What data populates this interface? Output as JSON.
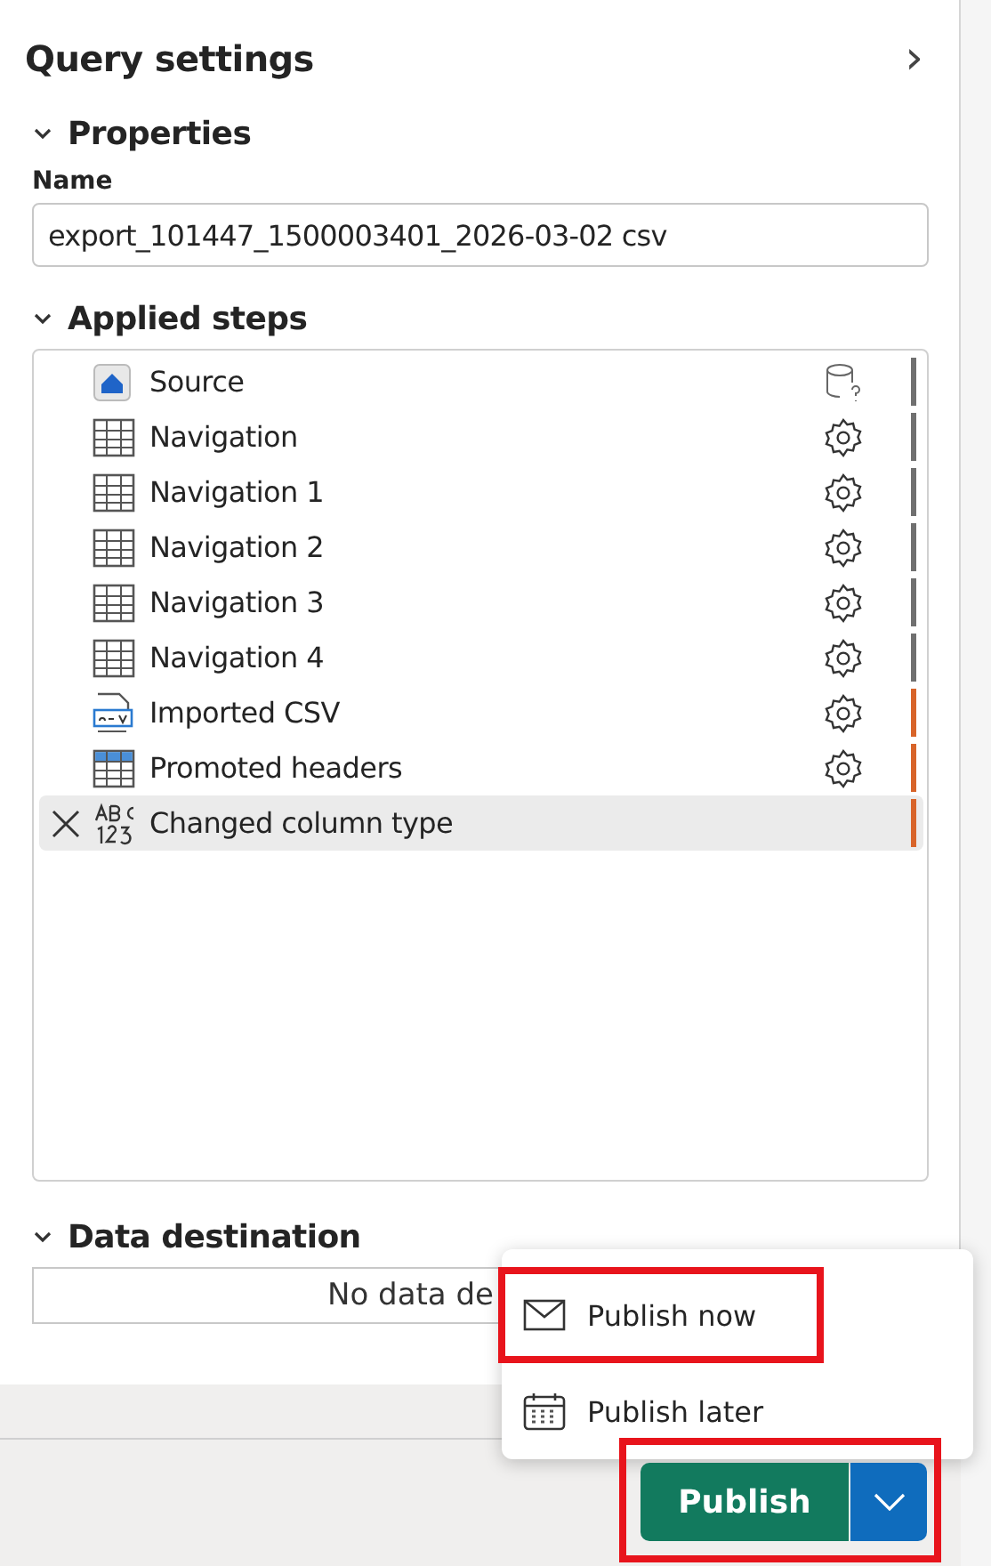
{
  "panel": {
    "title": "Query settings",
    "expand_icon": "›"
  },
  "properties": {
    "heading": "Properties",
    "expanded": true,
    "name_label": "Name",
    "name_value": "export_101447_1500003401_2026-03-02 csv"
  },
  "applied_steps": {
    "heading": "Applied steps",
    "expanded": true,
    "steps": [
      {
        "label": "Source",
        "kind": "source",
        "color": "#707070",
        "selected": false
      },
      {
        "label": "Navigation",
        "kind": "table",
        "settings": true,
        "color": "#707070",
        "selected": false
      },
      {
        "label": "Navigation 1",
        "kind": "table",
        "settings": true,
        "color": "#707070",
        "selected": false
      },
      {
        "label": "Navigation 2",
        "kind": "table",
        "settings": true,
        "color": "#707070",
        "selected": false
      },
      {
        "label": "Navigation 3",
        "kind": "table",
        "settings": true,
        "color": "#707070",
        "selected": false
      },
      {
        "label": "Navigation 4",
        "kind": "table",
        "settings": true,
        "color": "#707070",
        "selected": false
      },
      {
        "label": "Imported CSV",
        "kind": "csv",
        "settings": true,
        "color": "#d8642a",
        "selected": false
      },
      {
        "label": "Promoted headers",
        "kind": "headers",
        "settings": true,
        "color": "#d8642a",
        "selected": false
      },
      {
        "label": "Changed column type",
        "kind": "type",
        "settings": false,
        "color": "#d8642a",
        "selected": true
      }
    ]
  },
  "data_destination": {
    "heading": "Data destination",
    "expanded": true,
    "value": "No data de"
  },
  "publish_menu": {
    "items": [
      {
        "label": "Publish now",
        "kind": "mail",
        "highlighted": true
      },
      {
        "label": "Publish later",
        "kind": "calendar",
        "highlighted": false
      }
    ]
  },
  "publish_button": {
    "label": "Publish",
    "highlighted": true
  }
}
